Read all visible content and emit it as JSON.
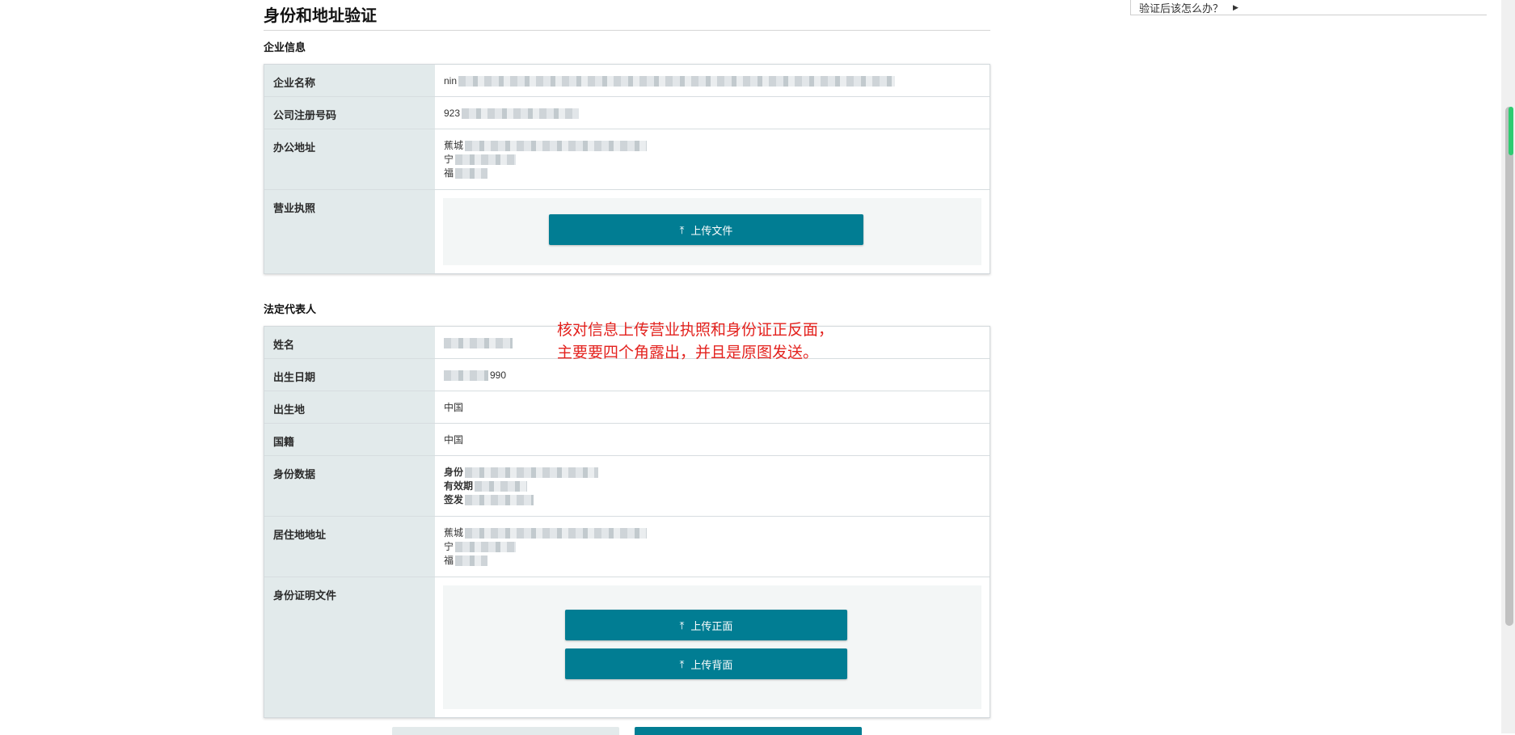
{
  "page": {
    "title": "身份和地址验证",
    "help_link": "验证后该怎么办？",
    "note_lines": [
      "核对信息上传营业执照和身份证正反面，",
      "主要要四个角露出，并且是原图发送。"
    ]
  },
  "company": {
    "section_title": "企业信息",
    "rows": {
      "name": {
        "label": "企业名称",
        "value": "nin"
      },
      "reg_no": {
        "label": "公司注册号码",
        "value": "923"
      },
      "office": {
        "label": "办公地址",
        "lines": [
          "蕉城",
          "宁",
          "福"
        ]
      },
      "license": {
        "label": "营业执照"
      }
    },
    "upload_label": "上传文件"
  },
  "legal_rep": {
    "section_title": "法定代表人",
    "rows": {
      "name": {
        "label": "姓名"
      },
      "dob": {
        "label": "出生日期",
        "value": "990"
      },
      "birthplace": {
        "label": "出生地",
        "value": "中国"
      },
      "nationality": {
        "label": "国籍",
        "value": "中国"
      },
      "id_data": {
        "label": "身份数据",
        "lines": [
          "身份",
          "有效期",
          "签发"
        ]
      },
      "address": {
        "label": "居住地地址",
        "lines": [
          "蕉城",
          "宁",
          "福"
        ]
      },
      "id_docs": {
        "label": "身份证明文件"
      }
    },
    "upload_front": "上传正面",
    "upload_back": "上传背面"
  },
  "colors": {
    "accent": "#017d93",
    "note": "#e3221e",
    "label_bg": "#e2eaeb",
    "upload_bg": "#f3f6f6",
    "scroll_accent": "#2ecc71"
  },
  "icons": {
    "upload": "upload-icon",
    "arrow": "triangle-right-icon"
  }
}
